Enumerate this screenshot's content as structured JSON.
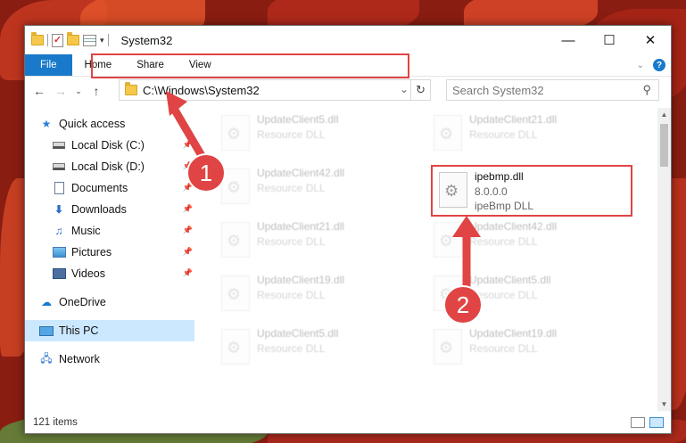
{
  "window": {
    "title": "System32"
  },
  "ribbon": {
    "tabs": [
      "File",
      "Home",
      "Share",
      "View"
    ]
  },
  "address": {
    "path": "C:\\Windows\\System32"
  },
  "search": {
    "placeholder": "Search System32"
  },
  "sidebar": {
    "items": [
      {
        "label": "Quick access",
        "icon": "star-icon",
        "pinned": false
      },
      {
        "label": "Local Disk (C:)",
        "icon": "drive-icon",
        "pinned": true
      },
      {
        "label": "Local Disk (D:)",
        "icon": "drive-icon",
        "pinned": true
      },
      {
        "label": "Documents",
        "icon": "documents-icon",
        "pinned": true
      },
      {
        "label": "Downloads",
        "icon": "download-icon",
        "pinned": true
      },
      {
        "label": "Music",
        "icon": "music-icon",
        "pinned": true
      },
      {
        "label": "Pictures",
        "icon": "pictures-icon",
        "pinned": true
      },
      {
        "label": "Videos",
        "icon": "videos-icon",
        "pinned": true
      },
      {
        "label": "OneDrive",
        "icon": "cloud-icon",
        "pinned": false
      },
      {
        "label": "This PC",
        "icon": "computer-icon",
        "pinned": false,
        "selected": true
      },
      {
        "label": "Network",
        "icon": "network-icon",
        "pinned": false
      }
    ]
  },
  "files": {
    "left": [
      {
        "name": "UpdateClient5.dll",
        "desc": "Resource DLL"
      },
      {
        "name": "UpdateClient42.dll",
        "desc": "Resource DLL"
      },
      {
        "name": "UpdateClient21.dll",
        "desc": "Resource DLL"
      },
      {
        "name": "UpdateClient19.dll",
        "desc": "Resource DLL"
      },
      {
        "name": "UpdateClient5.dll",
        "desc": "Resource DLL"
      }
    ],
    "right": [
      {
        "name": "UpdateClient21.dll",
        "desc": "Resource DLL"
      },
      {
        "name": "ipebmp.dll",
        "version": "8.0.0.0",
        "desc": "ipeBmp DLL",
        "highlighted": true
      },
      {
        "name": "UpdateClient42.dll",
        "desc": "Resource DLL"
      },
      {
        "name": "UpdateClient5.dll",
        "desc": "Resource DLL"
      },
      {
        "name": "UpdateClient19.dll",
        "desc": "Resource DLL"
      }
    ]
  },
  "status": {
    "items": "121 items"
  },
  "annotations": {
    "step1": "1",
    "step2": "2",
    "color": "#e04444"
  }
}
